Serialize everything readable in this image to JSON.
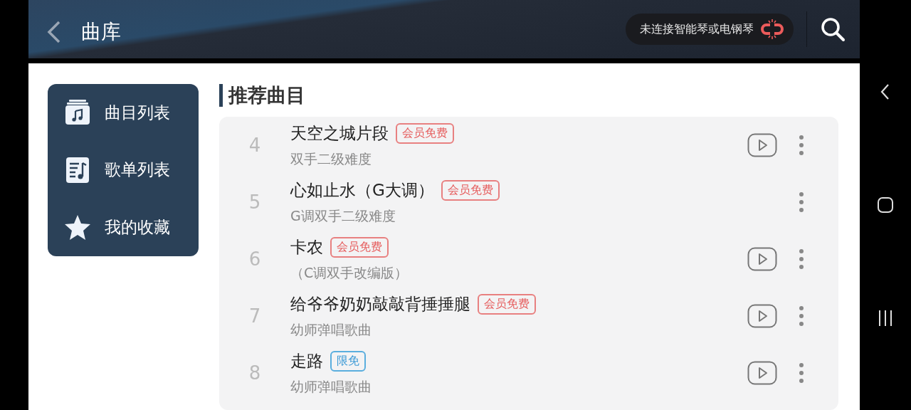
{
  "header": {
    "title": "曲库",
    "connection": "未连接智能琴或电钢琴"
  },
  "sidebar": {
    "items": [
      {
        "label": "曲目列表",
        "kind": "tracks"
      },
      {
        "label": "歌单列表",
        "kind": "playlists"
      },
      {
        "label": "我的收藏",
        "kind": "favorites"
      }
    ]
  },
  "section": {
    "title": "推荐曲目"
  },
  "songs": [
    {
      "number": "4",
      "title": "天空之城片段",
      "badge": {
        "text": "会员免费",
        "kind": "member"
      },
      "subtitle": "双手二级难度",
      "play": true
    },
    {
      "number": "5",
      "title": "心如止水（G大调）",
      "badge": {
        "text": "会员免费",
        "kind": "member"
      },
      "subtitle": "G调双手二级难度",
      "play": false
    },
    {
      "number": "6",
      "title": "卡农",
      "badge": {
        "text": "会员免费",
        "kind": "member"
      },
      "subtitle": "（C调双手改编版）",
      "play": true
    },
    {
      "number": "7",
      "title": "给爷爷奶奶敲敲背捶捶腿",
      "badge": {
        "text": "会员免费",
        "kind": "member"
      },
      "subtitle": "幼师弹唱歌曲",
      "play": true
    },
    {
      "number": "8",
      "title": "走路",
      "badge": {
        "text": "限免",
        "kind": "limited"
      },
      "subtitle": "幼师弹唱歌曲",
      "play": true
    }
  ]
}
